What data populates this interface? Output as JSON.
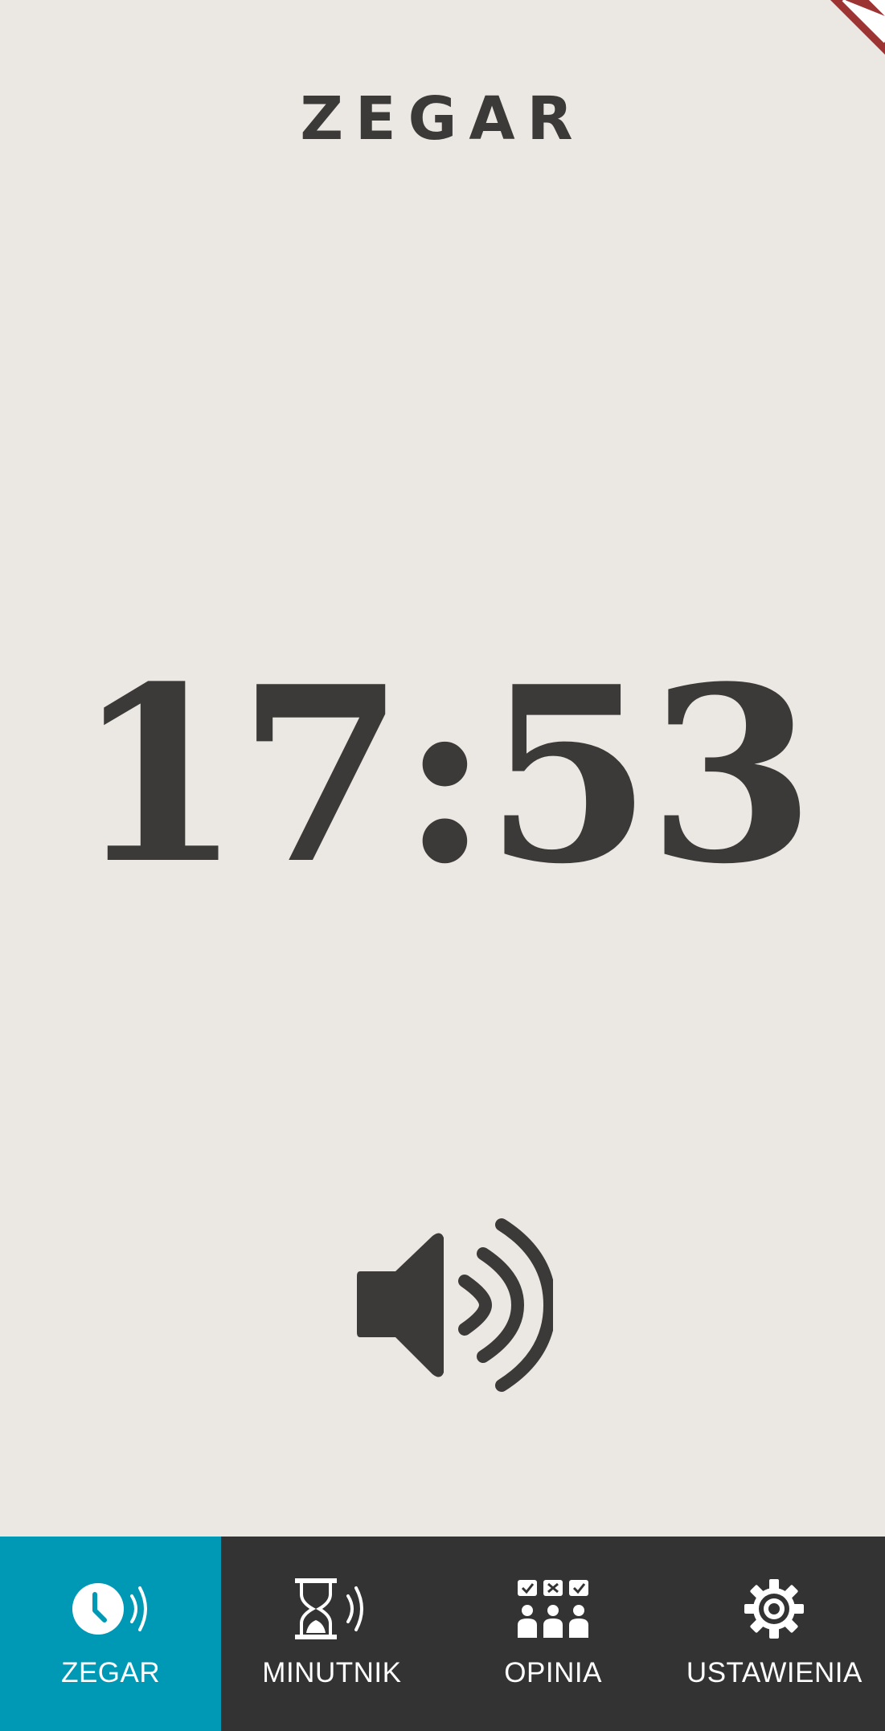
{
  "app": {
    "title": "ZEGAR"
  },
  "clock": {
    "time": "17:53"
  },
  "sound": {
    "icon": "speaker-wave-icon"
  },
  "nav": {
    "items": [
      {
        "id": "zegar",
        "label": "ZEGAR",
        "icon": "clock-speaker-icon",
        "active": true
      },
      {
        "id": "minutnik",
        "label": "MINUTNIK",
        "icon": "hourglass-speaker-icon",
        "active": false
      },
      {
        "id": "opinia",
        "label": "OPINIA",
        "icon": "people-vote-icon",
        "active": false
      },
      {
        "id": "ustawienia",
        "label": "USTAWIENIA",
        "icon": "gear-icon",
        "active": false
      }
    ]
  },
  "colors": {
    "background": "#ebe8e3",
    "text": "#3b3a38",
    "nav_background": "#333333",
    "nav_active": "#0099b5",
    "flag_red": "#9c3434",
    "flag_white": "#ffffff"
  }
}
